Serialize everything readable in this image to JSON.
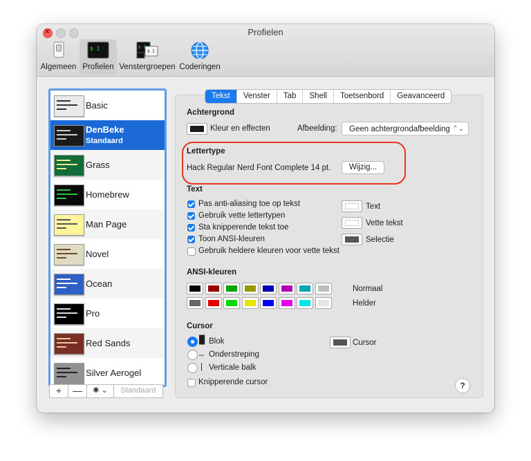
{
  "window": {
    "title": "Profielen"
  },
  "toolbar": {
    "items": [
      {
        "label": "Algemeen",
        "icon": "switch-icon"
      },
      {
        "label": "Profielen",
        "icon": "terminal-icon"
      },
      {
        "label": "Venstergroepen",
        "icon": "window-groups-icon"
      },
      {
        "label": "Coderingen",
        "icon": "globe-icon"
      }
    ],
    "icon_texts": {
      "profielen": "$ I",
      "vg_top": "$ I",
      "vg_bottom": "$ I"
    }
  },
  "sidebar": {
    "profiles": [
      {
        "name": "Basic",
        "subtitle": "",
        "thumb_bg": "#eaeaea",
        "thumb_fg": "#333333"
      },
      {
        "name": "DenBeke",
        "subtitle": "Standaard",
        "thumb_bg": "#1a1a1a",
        "thumb_fg": "#cfcfcf"
      },
      {
        "name": "Grass",
        "subtitle": "",
        "thumb_bg": "#136b3a",
        "thumb_fg": "#f0e68c"
      },
      {
        "name": "Homebrew",
        "subtitle": "",
        "thumb_bg": "#0a0a0a",
        "thumb_fg": "#27c93f"
      },
      {
        "name": "Man Page",
        "subtitle": "",
        "thumb_bg": "#fef49c",
        "thumb_fg": "#555555"
      },
      {
        "name": "Novel",
        "subtitle": "",
        "thumb_bg": "#dfdbc3",
        "thumb_fg": "#6b4a2e"
      },
      {
        "name": "Ocean",
        "subtitle": "",
        "thumb_bg": "#2d5fc4",
        "thumb_fg": "#ffffff"
      },
      {
        "name": "Pro",
        "subtitle": "",
        "thumb_bg": "#000000",
        "thumb_fg": "#dddddd"
      },
      {
        "name": "Red Sands",
        "subtitle": "",
        "thumb_bg": "#7a2f24",
        "thumb_fg": "#e8c9a1"
      },
      {
        "name": "Silver Aerogel",
        "subtitle": "",
        "thumb_bg": "#919191",
        "thumb_fg": "#222222"
      }
    ],
    "buttons": {
      "add": "+",
      "remove": "—",
      "gear": "✱ ⌄",
      "default": "Standaard"
    }
  },
  "tabs": [
    {
      "label": "Tekst",
      "selected": true
    },
    {
      "label": "Venster",
      "selected": false
    },
    {
      "label": "Tab",
      "selected": false
    },
    {
      "label": "Shell",
      "selected": false
    },
    {
      "label": "Toetsenbord",
      "selected": false
    },
    {
      "label": "Geavanceerd",
      "selected": false
    }
  ],
  "background": {
    "heading": "Achtergrond",
    "color_effects_label": "Kleur en effecten",
    "color": "#1c1c1c",
    "image_label": "Afbeelding:",
    "image_value": "Geen achtergrondafbeelding"
  },
  "font": {
    "heading": "Lettertype",
    "value": "Hack Regular Nerd Font Complete 14 pt.",
    "change_button": "Wijzig..."
  },
  "text": {
    "heading": "Text",
    "options": [
      {
        "label": "Pas anti-aliasing toe op tekst",
        "checked": true
      },
      {
        "label": "Gebruik vette lettertypen",
        "checked": true
      },
      {
        "label": "Sta knipperende tekst toe",
        "checked": true
      },
      {
        "label": "Toon ANSI-kleuren",
        "checked": true
      },
      {
        "label": "Gebruik heldere kleuren voor vette tekst",
        "checked": false
      }
    ],
    "colors": [
      {
        "label": "Text",
        "color": "#ffffff"
      },
      {
        "label": "Vette tekst",
        "color": "#ffffff"
      },
      {
        "label": "Selectie",
        "color": "#555555"
      }
    ]
  },
  "ansi": {
    "heading": "ANSI-kleuren",
    "normal_label": "Normaal",
    "bright_label": "Helder",
    "normal": [
      "#000000",
      "#990000",
      "#00a600",
      "#999900",
      "#0000b2",
      "#b200b2",
      "#00a6b2",
      "#bfbfbf"
    ],
    "bright": [
      "#666666",
      "#e50000",
      "#00d900",
      "#e5e500",
      "#0000ff",
      "#e500e5",
      "#00e5e5",
      "#e5e5e5"
    ]
  },
  "cursor": {
    "heading": "Cursor",
    "options": [
      {
        "glyph": "█",
        "label": "Blok",
        "selected": true
      },
      {
        "glyph": "_",
        "label": "Onderstreping",
        "selected": false
      },
      {
        "glyph": "|",
        "label": "Verticale balk",
        "selected": false
      }
    ],
    "color_label": "Cursor",
    "color": "#555555",
    "blink_label": "Knipperende cursor",
    "blink_checked": false
  },
  "help": "?",
  "colors": {
    "accent": "#1a7af0",
    "selection": "#1a69d6",
    "annotation": "#e8341f"
  }
}
